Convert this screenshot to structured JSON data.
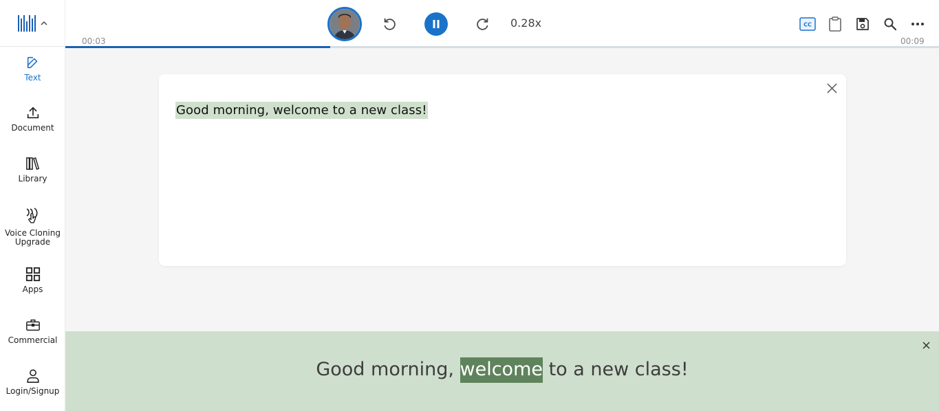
{
  "sidebar": {
    "items": [
      {
        "label": "Text",
        "icon": "pencil-icon",
        "active": true
      },
      {
        "label": "Document",
        "icon": "upload-icon"
      },
      {
        "label": "Library",
        "icon": "books-icon"
      },
      {
        "label": "Voice Cloning",
        "label2": "Upgrade",
        "icon": "voice-icon"
      },
      {
        "label": "Apps",
        "icon": "grid-icon"
      },
      {
        "label": "Commercial",
        "icon": "briefcase-icon"
      },
      {
        "label": "Login/Signup",
        "icon": "user-icon"
      }
    ]
  },
  "player": {
    "elapsed": "00:03",
    "total": "00:09",
    "progress_fraction": 0.303,
    "speed": "0.28x"
  },
  "toolbar_icons": [
    "cc-icon",
    "clipboard-icon",
    "save-icon",
    "search-icon",
    "more-icon"
  ],
  "card": {
    "text": "Good morning, welcome to a new class!"
  },
  "caption": {
    "before": "Good morning, ",
    "highlight": "welcome",
    "after": " to a new class!"
  },
  "colors": {
    "accent": "#1a73c9",
    "highlight_light": "#cfe0cc",
    "highlight_dark": "#5f835c",
    "caption_bg": "#cfdfcd"
  }
}
